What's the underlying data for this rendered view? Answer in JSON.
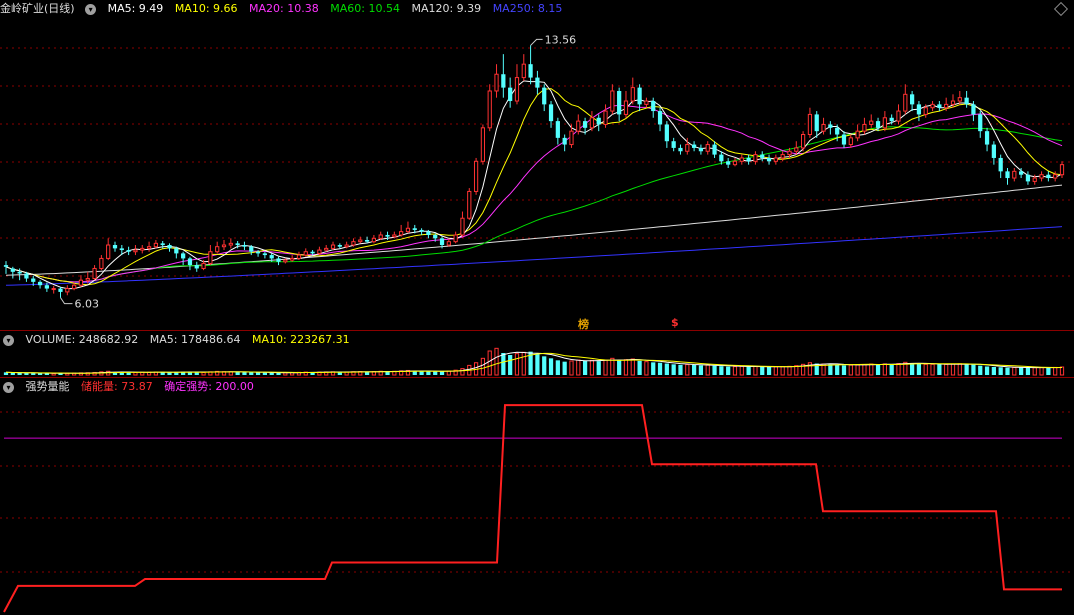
{
  "main": {
    "title": "金岭矿业(日线)",
    "ma": [
      {
        "label": "MA5: 9.49",
        "color": "#ffffff"
      },
      {
        "label": "MA10: 9.66",
        "color": "#ffff00"
      },
      {
        "label": "MA20: 10.38",
        "color": "#ff33ff"
      },
      {
        "label": "MA60: 10.54",
        "color": "#00dd00"
      },
      {
        "label": "MA120: 9.39",
        "color": "#dddddd"
      },
      {
        "label": "MA250: 8.15",
        "color": "#3333ff"
      }
    ],
    "high_label": "13.56",
    "low_label": "6.03",
    "badge1": "榜",
    "badge2": "$"
  },
  "volume": {
    "title": "VOLUME: 248682.92",
    "ma5": "MA5: 178486.64",
    "ma10": "MA10: 223267.31"
  },
  "indicator": {
    "title": "强势量能",
    "storage": "储能量: 73.87",
    "confirm": "确定强势: 200.00"
  },
  "colors": {
    "up": "#ff3232",
    "down": "#54ffff",
    "grid": "#8b0000",
    "ind_line": "#ff2020",
    "ind_level": "#cc00cc"
  },
  "chart_data": {
    "type": "candlestick",
    "ylim": [
      5.6,
      14.2
    ],
    "high": 13.56,
    "low": 6.03,
    "candles": [
      [
        7.0,
        6.95,
        6.74,
        7.12
      ],
      [
        6.9,
        6.8,
        6.6,
        6.95
      ],
      [
        6.8,
        6.75,
        6.55,
        6.9
      ],
      [
        6.75,
        6.6,
        6.5,
        6.8
      ],
      [
        6.6,
        6.5,
        6.38,
        6.68
      ],
      [
        6.5,
        6.4,
        6.3,
        6.55
      ],
      [
        6.4,
        6.3,
        6.2,
        6.48
      ],
      [
        6.3,
        6.3,
        6.15,
        6.38
      ],
      [
        6.3,
        6.2,
        6.03,
        6.35
      ],
      [
        6.2,
        6.3,
        6.1,
        6.4
      ],
      [
        6.3,
        6.4,
        6.25,
        6.5
      ],
      [
        6.4,
        6.55,
        6.35,
        6.7
      ],
      [
        6.55,
        6.6,
        6.45,
        6.8
      ],
      [
        6.6,
        6.9,
        6.55,
        7.0
      ],
      [
        6.9,
        7.2,
        6.85,
        7.3
      ],
      [
        7.2,
        7.6,
        7.15,
        7.8
      ],
      [
        7.6,
        7.5,
        7.4,
        7.7
      ],
      [
        7.5,
        7.45,
        7.3,
        7.6
      ],
      [
        7.45,
        7.4,
        7.3,
        7.55
      ],
      [
        7.4,
        7.45,
        7.3,
        7.6
      ],
      [
        7.45,
        7.5,
        7.35,
        7.6
      ],
      [
        7.5,
        7.55,
        7.4,
        7.7
      ],
      [
        7.55,
        7.65,
        7.5,
        7.75
      ],
      [
        7.65,
        7.6,
        7.5,
        7.72
      ],
      [
        7.6,
        7.5,
        7.4,
        7.65
      ],
      [
        7.5,
        7.35,
        7.2,
        7.55
      ],
      [
        7.35,
        7.2,
        7.0,
        7.4
      ],
      [
        7.2,
        7.0,
        6.85,
        7.25
      ],
      [
        7.0,
        6.9,
        6.8,
        7.1
      ],
      [
        6.9,
        7.05,
        6.85,
        7.15
      ],
      [
        7.05,
        7.4,
        7.0,
        7.6
      ],
      [
        7.4,
        7.55,
        7.35,
        7.7
      ],
      [
        7.55,
        7.6,
        7.45,
        7.75
      ],
      [
        7.6,
        7.65,
        7.5,
        7.8
      ],
      [
        7.65,
        7.6,
        7.5,
        7.72
      ],
      [
        7.6,
        7.55,
        7.45,
        7.7
      ],
      [
        7.55,
        7.4,
        7.3,
        7.6
      ],
      [
        7.4,
        7.35,
        7.25,
        7.45
      ],
      [
        7.35,
        7.3,
        7.2,
        7.4
      ],
      [
        7.3,
        7.2,
        7.1,
        7.35
      ],
      [
        7.2,
        7.1,
        7.0,
        7.25
      ],
      [
        7.1,
        7.15,
        7.05,
        7.2
      ],
      [
        7.15,
        7.2,
        7.1,
        7.3
      ],
      [
        7.2,
        7.3,
        7.15,
        7.4
      ],
      [
        7.3,
        7.4,
        7.25,
        7.5
      ],
      [
        7.4,
        7.35,
        7.3,
        7.45
      ],
      [
        7.35,
        7.45,
        7.3,
        7.55
      ],
      [
        7.45,
        7.5,
        7.4,
        7.6
      ],
      [
        7.5,
        7.6,
        7.45,
        7.7
      ],
      [
        7.6,
        7.55,
        7.5,
        7.65
      ],
      [
        7.55,
        7.6,
        7.5,
        7.7
      ],
      [
        7.6,
        7.7,
        7.55,
        7.8
      ],
      [
        7.7,
        7.75,
        7.65,
        7.85
      ],
      [
        7.75,
        7.7,
        7.65,
        7.85
      ],
      [
        7.7,
        7.8,
        7.65,
        7.9
      ],
      [
        7.8,
        7.9,
        7.75,
        8.0
      ],
      [
        7.9,
        7.85,
        7.75,
        8.0
      ],
      [
        7.85,
        7.9,
        7.8,
        8.0
      ],
      [
        7.9,
        8.0,
        7.85,
        8.2
      ],
      [
        8.0,
        8.1,
        7.95,
        8.3
      ],
      [
        8.1,
        8.05,
        7.95,
        8.2
      ],
      [
        8.05,
        8.0,
        7.9,
        8.1
      ],
      [
        8.0,
        7.9,
        7.8,
        8.05
      ],
      [
        7.9,
        7.8,
        7.7,
        7.95
      ],
      [
        7.8,
        7.6,
        7.5,
        7.85
      ],
      [
        7.6,
        7.7,
        7.55,
        7.8
      ],
      [
        7.7,
        7.9,
        7.65,
        8.0
      ],
      [
        7.9,
        8.4,
        7.85,
        8.6
      ],
      [
        8.4,
        9.2,
        8.35,
        9.3
      ],
      [
        9.2,
        10.1,
        9.1,
        10.2
      ],
      [
        10.1,
        11.1,
        10.0,
        11.2
      ],
      [
        11.1,
        12.2,
        11.0,
        12.4
      ],
      [
        12.2,
        12.7,
        12.0,
        13.0
      ],
      [
        12.7,
        12.3,
        12.0,
        13.3
      ],
      [
        12.3,
        11.9,
        11.7,
        12.6
      ],
      [
        11.9,
        12.6,
        11.8,
        13.0
      ],
      [
        12.6,
        13.0,
        12.5,
        13.3
      ],
      [
        13.0,
        12.6,
        12.4,
        13.56
      ],
      [
        12.6,
        12.3,
        12.1,
        12.8
      ],
      [
        12.3,
        11.8,
        11.6,
        12.4
      ],
      [
        11.8,
        11.3,
        11.1,
        11.9
      ],
      [
        11.3,
        10.8,
        10.6,
        11.4
      ],
      [
        10.8,
        10.6,
        10.4,
        10.9
      ],
      [
        10.6,
        11.0,
        10.5,
        11.2
      ],
      [
        11.0,
        11.3,
        10.9,
        11.5
      ],
      [
        11.3,
        11.1,
        10.9,
        11.4
      ],
      [
        11.1,
        11.4,
        11.0,
        11.6
      ],
      [
        11.4,
        11.2,
        11.0,
        11.5
      ],
      [
        11.2,
        11.6,
        11.1,
        11.8
      ],
      [
        11.6,
        12.2,
        11.5,
        12.4
      ],
      [
        12.2,
        11.5,
        11.3,
        12.3
      ],
      [
        11.5,
        11.9,
        11.4,
        12.2
      ],
      [
        11.9,
        12.3,
        11.8,
        12.6
      ],
      [
        12.3,
        11.8,
        11.6,
        12.4
      ],
      [
        11.8,
        11.9,
        11.7,
        12.0
      ],
      [
        11.9,
        11.6,
        11.4,
        12.0
      ],
      [
        11.6,
        11.2,
        11.0,
        11.7
      ],
      [
        11.2,
        10.7,
        10.5,
        11.3
      ],
      [
        10.7,
        10.5,
        10.4,
        10.8
      ],
      [
        10.5,
        10.4,
        10.3,
        10.6
      ],
      [
        10.4,
        10.6,
        10.3,
        10.8
      ],
      [
        10.6,
        10.5,
        10.4,
        10.7
      ],
      [
        10.5,
        10.4,
        10.3,
        10.6
      ],
      [
        10.4,
        10.6,
        10.3,
        10.7
      ],
      [
        10.6,
        10.3,
        10.2,
        10.7
      ],
      [
        10.3,
        10.1,
        10.0,
        10.4
      ],
      [
        10.1,
        10.0,
        9.9,
        10.2
      ],
      [
        10.0,
        10.1,
        9.95,
        10.2
      ],
      [
        10.1,
        10.2,
        10.0,
        10.3
      ],
      [
        10.2,
        10.1,
        10.0,
        10.3
      ],
      [
        10.1,
        10.3,
        10.0,
        10.4
      ],
      [
        10.3,
        10.2,
        10.1,
        10.4
      ],
      [
        10.2,
        10.1,
        10.0,
        10.3
      ],
      [
        10.1,
        10.2,
        10.0,
        10.3
      ],
      [
        10.2,
        10.3,
        10.1,
        10.4
      ],
      [
        10.3,
        10.4,
        10.2,
        10.5
      ],
      [
        10.4,
        10.5,
        10.3,
        10.7
      ],
      [
        10.5,
        10.9,
        10.4,
        11.0
      ],
      [
        10.9,
        11.5,
        10.8,
        11.7
      ],
      [
        11.5,
        11.0,
        10.8,
        11.6
      ],
      [
        11.0,
        11.2,
        10.9,
        11.4
      ],
      [
        11.2,
        11.1,
        10.9,
        11.3
      ],
      [
        11.1,
        10.9,
        10.7,
        11.2
      ],
      [
        10.9,
        10.6,
        10.5,
        11.0
      ],
      [
        10.6,
        10.8,
        10.5,
        10.9
      ],
      [
        10.8,
        11.0,
        10.7,
        11.2
      ],
      [
        11.0,
        11.2,
        10.9,
        11.4
      ],
      [
        11.2,
        11.3,
        11.1,
        11.5
      ],
      [
        11.3,
        11.1,
        11.0,
        11.4
      ],
      [
        11.1,
        11.4,
        11.0,
        11.6
      ],
      [
        11.4,
        11.3,
        11.2,
        11.5
      ],
      [
        11.3,
        11.6,
        11.2,
        11.8
      ],
      [
        11.6,
        12.1,
        11.5,
        12.4
      ],
      [
        12.1,
        11.8,
        11.6,
        12.2
      ],
      [
        11.8,
        11.5,
        11.3,
        11.9
      ],
      [
        11.5,
        11.7,
        11.4,
        11.8
      ],
      [
        11.7,
        11.8,
        11.6,
        11.9
      ],
      [
        11.8,
        11.7,
        11.6,
        11.9
      ],
      [
        11.7,
        11.8,
        11.6,
        12.0
      ],
      [
        11.8,
        11.9,
        11.7,
        12.1
      ],
      [
        11.9,
        12.0,
        11.8,
        12.2
      ],
      [
        12.0,
        11.8,
        11.7,
        12.2
      ],
      [
        11.8,
        11.5,
        11.3,
        11.9
      ],
      [
        11.5,
        11.0,
        10.8,
        11.6
      ],
      [
        11.0,
        10.6,
        10.4,
        11.1
      ],
      [
        10.6,
        10.2,
        10.0,
        10.7
      ],
      [
        10.2,
        9.8,
        9.6,
        10.3
      ],
      [
        9.8,
        9.6,
        9.4,
        9.9
      ],
      [
        9.6,
        9.8,
        9.5,
        9.9
      ],
      [
        9.8,
        9.7,
        9.6,
        9.9
      ],
      [
        9.7,
        9.5,
        9.4,
        9.8
      ],
      [
        9.5,
        9.6,
        9.4,
        9.7
      ],
      [
        9.6,
        9.7,
        9.5,
        9.8
      ],
      [
        9.7,
        9.6,
        9.5,
        9.8
      ],
      [
        9.6,
        9.7,
        9.5,
        9.8
      ],
      [
        9.7,
        10.0,
        9.6,
        10.1
      ]
    ],
    "volumes": [
      20,
      18,
      16,
      15,
      14,
      13,
      12,
      12,
      12,
      13,
      14,
      16,
      17,
      19,
      24,
      28,
      22,
      20,
      19,
      19,
      20,
      21,
      22,
      20,
      19,
      22,
      24,
      26,
      20,
      19,
      24,
      27,
      25,
      24,
      22,
      20,
      21,
      19,
      18,
      17,
      16,
      17,
      18,
      20,
      22,
      21,
      22,
      23,
      24,
      22,
      23,
      25,
      26,
      24,
      26,
      28,
      27,
      28,
      31,
      34,
      30,
      28,
      27,
      26,
      28,
      30,
      36,
      48,
      72,
      92,
      125,
      180,
      200,
      165,
      150,
      160,
      170,
      175,
      158,
      140,
      125,
      110,
      100,
      105,
      112,
      108,
      110,
      104,
      112,
      125,
      110,
      115,
      120,
      106,
      100,
      95,
      92,
      86,
      80,
      76,
      78,
      75,
      72,
      74,
      70,
      66,
      63,
      63,
      65,
      62,
      64,
      61,
      60,
      62,
      63,
      65,
      70,
      80,
      92,
      86,
      82,
      80,
      77,
      72,
      74,
      76,
      79,
      82,
      80,
      83,
      82,
      86,
      95,
      90,
      84,
      80,
      80,
      79,
      80,
      82,
      84,
      82,
      78,
      70,
      64,
      60,
      58,
      55,
      57,
      56,
      54,
      55,
      56,
      55,
      57,
      60
    ]
  }
}
